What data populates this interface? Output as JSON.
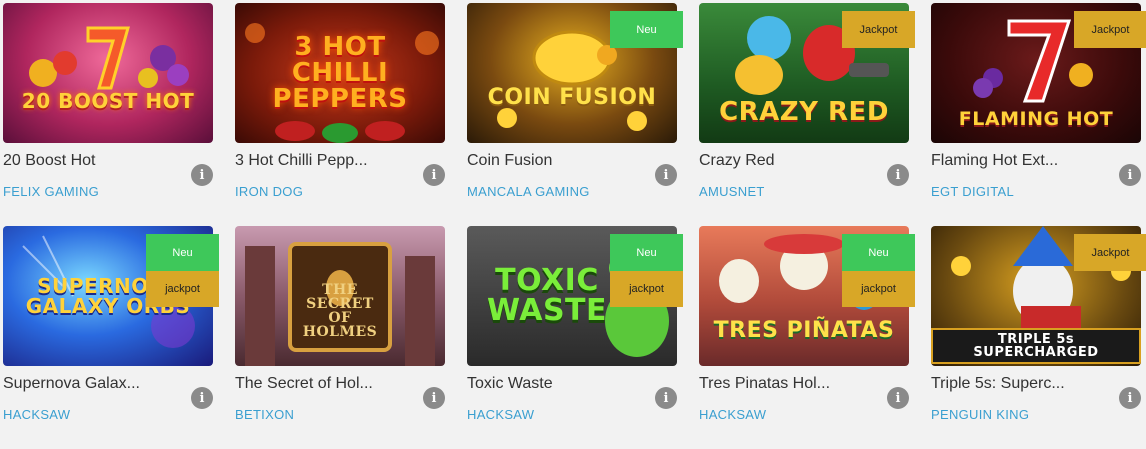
{
  "games": [
    {
      "title": "20 Boost Hot",
      "provider": "FELIX GAMING",
      "logo": "20 BOOST HOT",
      "badges": []
    },
    {
      "title": "3 Hot Chilli Pepp...",
      "provider": "IRON DOG",
      "logo": "3 HOT CHILLI PEPPERS",
      "badges": []
    },
    {
      "title": "Coin Fusion",
      "provider": "MANCALA GAMING",
      "logo": "COIN FUSION",
      "badges": [
        "Neu"
      ]
    },
    {
      "title": "Crazy Red",
      "provider": "AMUSNET",
      "logo": "CRAZY RED",
      "badges": [
        "Jackpot"
      ]
    },
    {
      "title": "Flaming Hot Ext...",
      "provider": "EGT DIGITAL",
      "logo": "FLAMING HOT",
      "badges": [
        "Jackpot"
      ]
    },
    {
      "title": "Supernova Galax...",
      "provider": "HACKSAW",
      "logo": "SUPERNOVA GALAXY ORBS",
      "badges": [
        "Neu",
        "jackpot"
      ]
    },
    {
      "title": "The Secret of Hol...",
      "provider": "BETIXON",
      "logo": "THE SECRET OF HOLMES",
      "badges": []
    },
    {
      "title": "Toxic Waste",
      "provider": "HACKSAW",
      "logo": "TOXIC WASTE",
      "badges": [
        "Neu",
        "jackpot"
      ]
    },
    {
      "title": "Tres Pinatas Hol...",
      "provider": "HACKSAW",
      "logo": "TRES PIÑATAS",
      "badges": [
        "Neu",
        "jackpot"
      ]
    },
    {
      "title": "Triple 5s: Superc...",
      "provider": "PENGUIN KING",
      "logo": "TRIPLE 5s SUPERCHARGED",
      "badges": [
        "Jackpot"
      ]
    }
  ],
  "info_icon": "info-icon",
  "colors": {
    "provider": "#3a9fd0",
    "badge_neu": "#3ec85a",
    "badge_jackpot": "#d8a727",
    "background": "#f2f2f2"
  }
}
